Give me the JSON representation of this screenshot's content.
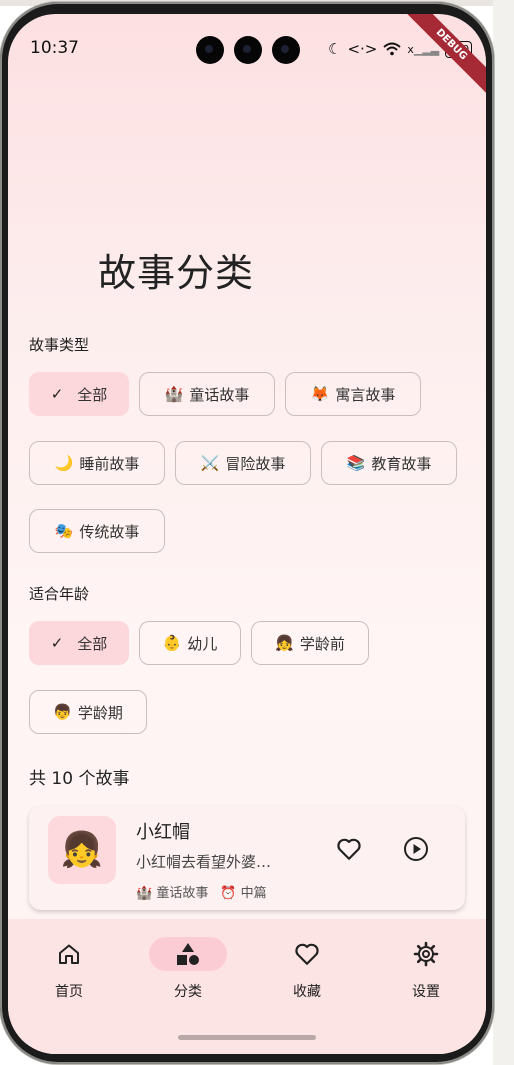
{
  "status_bar": {
    "time": "10:37",
    "signal_x": "x",
    "battery": "100",
    "debug": "DEBUG"
  },
  "page": {
    "title": "故事分类"
  },
  "filters": {
    "type_label": "故事类型",
    "types": [
      {
        "icon": "✓",
        "label": "全部",
        "selected": true
      },
      {
        "icon": "🏰",
        "label": "童话故事",
        "selected": false
      },
      {
        "icon": "🦊",
        "label": "寓言故事",
        "selected": false
      },
      {
        "icon": "🌙",
        "label": "睡前故事",
        "selected": false
      },
      {
        "icon": "⚔️",
        "label": "冒险故事",
        "selected": false
      },
      {
        "icon": "📚",
        "label": "教育故事",
        "selected": false
      },
      {
        "icon": "🎭",
        "label": "传统故事",
        "selected": false
      }
    ],
    "age_label": "适合年龄",
    "ages": [
      {
        "icon": "✓",
        "label": "全部",
        "selected": true
      },
      {
        "icon": "👶",
        "label": "幼儿",
        "selected": false
      },
      {
        "icon": "👧",
        "label": "学龄前",
        "selected": false
      },
      {
        "icon": "👦",
        "label": "学龄期",
        "selected": false
      }
    ]
  },
  "results": {
    "count_label": "共 10 个故事",
    "stories": [
      {
        "emoji": "👧",
        "title": "小红帽",
        "description": "小红帽去看望外婆…",
        "category_icon": "🏰",
        "category": "童话故事",
        "length_icon": "⏰",
        "length": "中篇"
      }
    ]
  },
  "nav": {
    "items": [
      {
        "label": "首页",
        "icon": "home-icon",
        "active": false
      },
      {
        "label": "分类",
        "icon": "category-icon",
        "active": true
      },
      {
        "label": "收藏",
        "icon": "heart-icon",
        "active": false
      },
      {
        "label": "设置",
        "icon": "gear-icon",
        "active": false
      }
    ]
  },
  "colors": {
    "accent": "#fcd7dc",
    "nav_bg": "#fce3e4",
    "debug_ribbon": "#a52a36"
  }
}
